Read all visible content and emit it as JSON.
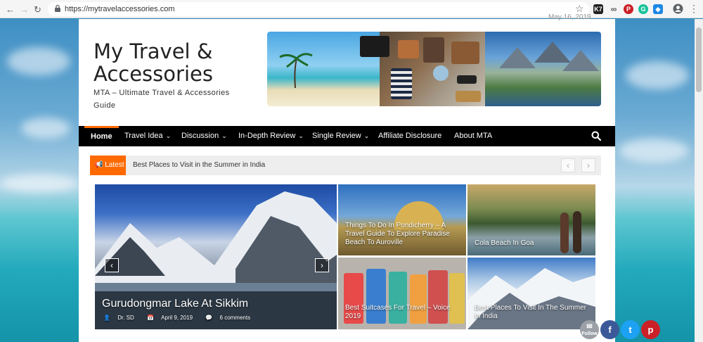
{
  "browser": {
    "url": "https://mytravelaccessories.com",
    "extensions": [
      "K7",
      "∞",
      "P",
      "G",
      "◆"
    ]
  },
  "site": {
    "title": "My Travel & Accessories",
    "tagline": "MTA – Ultimate Travel & Accessories Guide",
    "date_partial": "May 16, 2019"
  },
  "menu": {
    "items": [
      {
        "label": "Home",
        "dropdown": false
      },
      {
        "label": "Travel Idea",
        "dropdown": true
      },
      {
        "label": "Discussion",
        "dropdown": true
      },
      {
        "label": "In-Depth Review",
        "dropdown": true
      },
      {
        "label": "Single Review",
        "dropdown": true
      },
      {
        "label": "Affiliate Disclosure",
        "dropdown": false
      },
      {
        "label": "About MTA",
        "dropdown": false
      }
    ]
  },
  "ticker": {
    "tag": "Latest",
    "headline": "Best Places to Visit in the Summer in India"
  },
  "featured": {
    "main": {
      "title": "Gurudongmar Lake At Sikkim",
      "author": "Dr. SD",
      "date": "April 9, 2019",
      "comments": "6 comments"
    },
    "cards": [
      {
        "title": "Things To Do In Pondicherry – A Travel Guide To Explore Paradise Beach To Auroville"
      },
      {
        "title": "Cola Beach In Goa"
      },
      {
        "title": "Best Suitcases For Travel – Voice 2019"
      },
      {
        "title": "Best Places To Visit In The Summer In India"
      }
    ]
  },
  "social": {
    "follow_label": "Follow",
    "items": [
      "f",
      "t",
      "p"
    ]
  },
  "colors": {
    "accent": "#ff6a00",
    "menu_bg": "#000000",
    "facebook": "#3b5998",
    "twitter": "#1da1f2",
    "pinterest": "#cb2027"
  }
}
